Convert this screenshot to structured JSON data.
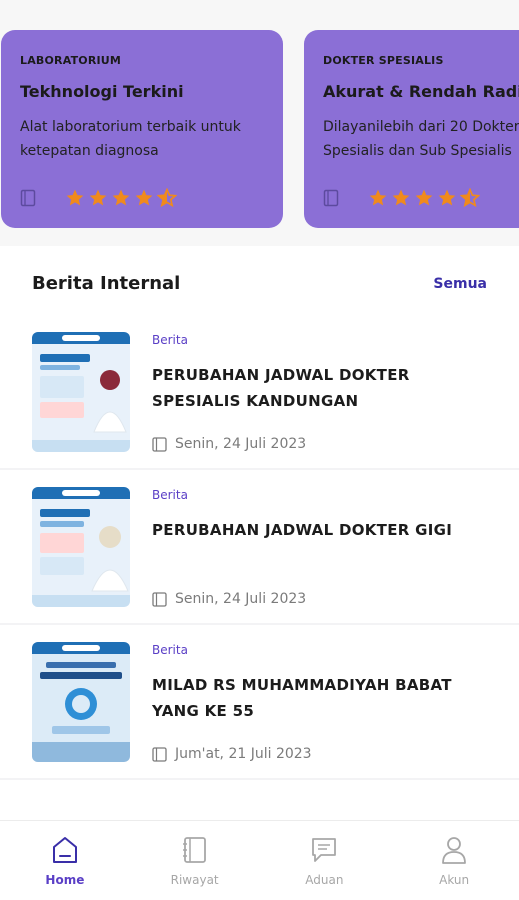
{
  "colors": {
    "card_bg": "#8b6fd6",
    "accent": "#5a3fc6",
    "link": "#3a2fa8",
    "star": "#f08a1c",
    "inactive": "#a7a7a7"
  },
  "cards": [
    {
      "category": "LABORATORIUM",
      "title": "Tekhnologi Terkini",
      "desc_line1": "Alat laboratorium terbaik untuk",
      "desc_line2": "ketepatan diagnosa",
      "rating": 4.5,
      "icon": "document-icon"
    },
    {
      "category": "DOKTER SPESIALIS",
      "title": "Akurat & Rendah Radiasi",
      "desc_line1": "Dilayanilebih dari 20 Dokter",
      "desc_line2": "Spesialis dan Sub Spesialis",
      "rating": 4.5,
      "icon": "document-icon"
    }
  ],
  "section": {
    "title": "Berita Internal",
    "see_all": "Semua"
  },
  "news": [
    {
      "tag": "Berita",
      "title": "PERUBAHAN JADWAL DOKTER SPESIALIS KANDUNGAN",
      "date": "Senin, 24 Juli 2023"
    },
    {
      "tag": "Berita",
      "title": "PERUBAHAN JADWAL DOKTER GIGI",
      "date": "Senin, 24 Juli 2023"
    },
    {
      "tag": "Berita",
      "title": "MILAD RS MUHAMMADIYAH BABAT YANG KE 55",
      "date": "Jum'at, 21 Juli 2023"
    }
  ],
  "nav": [
    {
      "label": "Home",
      "icon": "home-icon",
      "active": true
    },
    {
      "label": "Riwayat",
      "icon": "notebook-icon",
      "active": false
    },
    {
      "label": "Aduan",
      "icon": "message-icon",
      "active": false
    },
    {
      "label": "Akun",
      "icon": "user-icon",
      "active": false
    }
  ]
}
